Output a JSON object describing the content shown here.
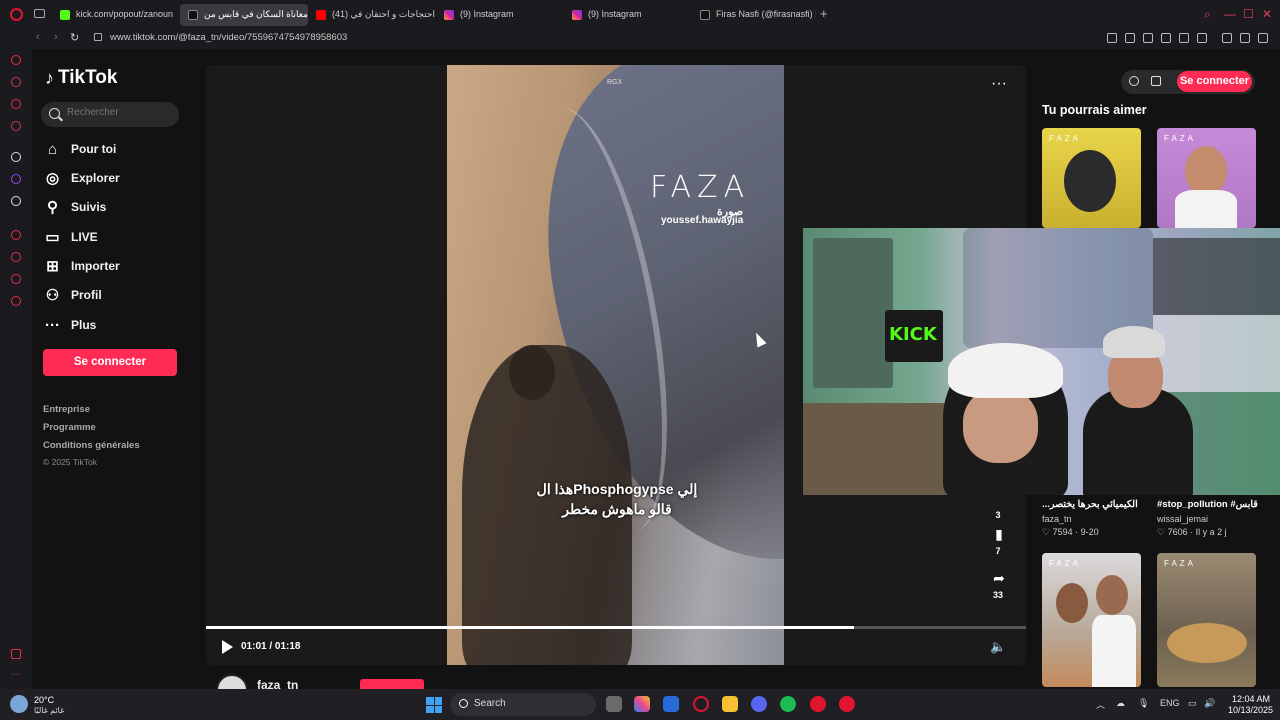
{
  "browser": {
    "tabs": [
      {
        "label": "kick.com/popout/zanoun",
        "active": false
      },
      {
        "label": "معاناة السكان في قابس من",
        "active": true
      },
      {
        "label": "احتجاجات و احتقان في (41)",
        "active": false
      },
      {
        "label": "(9) Instagram",
        "active": false
      },
      {
        "label": "(9) Instagram",
        "active": false
      },
      {
        "label": "Firas Nasfi (@firasnasfi) |",
        "active": false
      }
    ],
    "new_tab": "+",
    "url": "www.tiktok.com/@faza_tn/video/7559674754978958603"
  },
  "tiktok": {
    "logo": "TikTok",
    "search_placeholder": "Rechercher",
    "nav": [
      {
        "label": "Pour toi",
        "icon": "home-icon"
      },
      {
        "label": "Explorer",
        "icon": "compass-icon"
      },
      {
        "label": "Suivis",
        "icon": "user-plus-icon"
      },
      {
        "label": "LIVE",
        "icon": "tv-icon"
      },
      {
        "label": "Importer",
        "icon": "plus-square-icon"
      },
      {
        "label": "Profil",
        "icon": "user-icon"
      },
      {
        "label": "Plus",
        "icon": "more-dots-icon"
      }
    ],
    "connect_label": "Se connecter",
    "footer": [
      "Entreprise",
      "Programme",
      "Conditions générales"
    ],
    "copyright": "© 2025 TikTok"
  },
  "video": {
    "watermark_small": "RGX",
    "brand": "FAZA",
    "brand_sub1": "صورة",
    "brand_sub2": "youssef.hawayjia",
    "caption_line1": "هذا الPhosphogypse إلي",
    "caption_line2": "قالو ماهوش مخطر",
    "time": "01:01 / 01:18",
    "progress": 0.79,
    "side_counts": {
      "comments": "3",
      "saves": "7",
      "shares": "33"
    },
    "author": "faza_tn"
  },
  "right": {
    "connect_label": "Se connecter",
    "section_title": "Tu pourrais aimer",
    "cards": [
      {
        "title": "...الكيميائي بحرها يختصر",
        "author": "faza_tn",
        "likes": "7594",
        "date": "9-20"
      },
      {
        "title": "#stop_pollution #قابس",
        "author": "wissal_jemai",
        "likes": "7606",
        "date": "Il y a 2 j"
      }
    ],
    "thumb_tag": "FAZA"
  },
  "webcam": {
    "sign": "KICK"
  },
  "taskbar": {
    "weather_temp": "20°C",
    "weather_desc": "غائم غالبًا",
    "search_label": "Search",
    "lang": "ENG",
    "time": "12:04 AM",
    "date": "10/13/2025"
  }
}
